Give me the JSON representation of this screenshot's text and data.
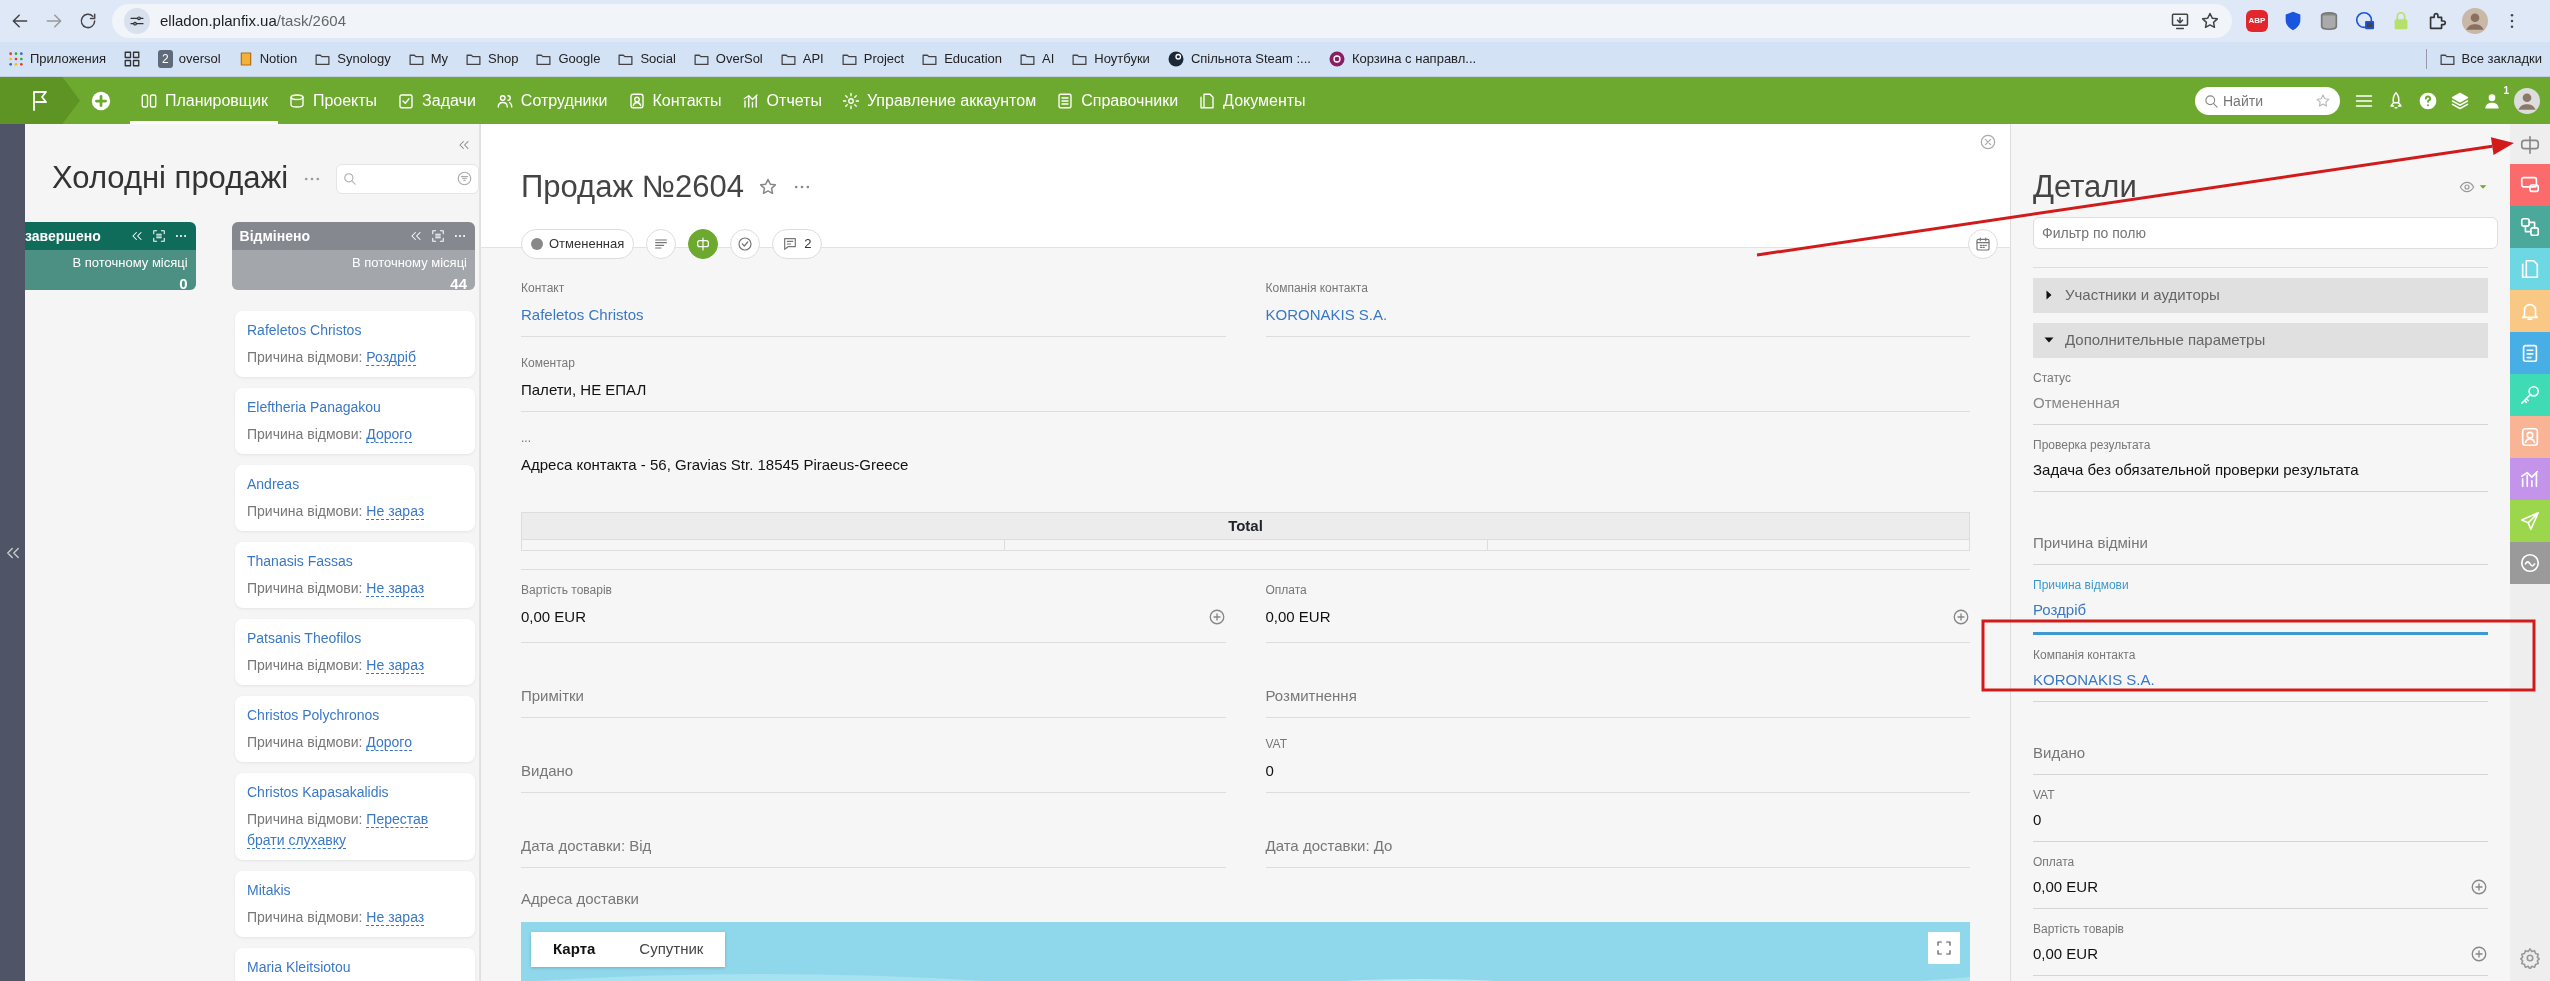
{
  "browser": {
    "url_host": "elladon.planfix.ua",
    "url_path": "/task/2604",
    "extension_label": "ABP",
    "bookmarks": [
      {
        "kind": "apps",
        "label": "Приложения"
      },
      {
        "kind": "grid"
      },
      {
        "kind": "badge",
        "badge": "2",
        "label": "oversol"
      },
      {
        "kind": "notebook",
        "label": "Notion"
      },
      {
        "kind": "folder",
        "label": "Synology"
      },
      {
        "kind": "folder",
        "label": "My"
      },
      {
        "kind": "folder",
        "label": "Shop"
      },
      {
        "kind": "folder",
        "label": "Google"
      },
      {
        "kind": "folder",
        "label": "Social"
      },
      {
        "kind": "folder",
        "label": "OverSol"
      },
      {
        "kind": "folder",
        "label": "API"
      },
      {
        "kind": "folder",
        "label": "Project"
      },
      {
        "kind": "folder",
        "label": "Education"
      },
      {
        "kind": "folder",
        "label": "AI"
      },
      {
        "kind": "folder",
        "label": "Ноутбуки"
      },
      {
        "kind": "steam",
        "label": "Спільнота Steam :..."
      },
      {
        "kind": "site",
        "label": "Корзина с направл..."
      }
    ],
    "all_bookmarks": "Все закладки"
  },
  "app_nav": {
    "items": [
      {
        "label": "Планировщик",
        "selected": true
      },
      {
        "label": "Проекты",
        "selected": false
      },
      {
        "label": "Задачи",
        "selected": false
      },
      {
        "label": "Сотрудники",
        "selected": false
      },
      {
        "label": "Контакты",
        "selected": false
      },
      {
        "label": "Отчеты",
        "selected": false
      },
      {
        "label": "Управление аккаунтом",
        "selected": false
      },
      {
        "label": "Справочники",
        "selected": false
      },
      {
        "label": "Документы",
        "selected": false
      }
    ],
    "search": {
      "placeholder": "Найти"
    },
    "user_badge": "1"
  },
  "board": {
    "title": "Холодні продажі",
    "columns": [
      {
        "title": "завершено",
        "period": "В поточному місяці",
        "count": "0",
        "color": "#0f6b5a"
      },
      {
        "title": "Відмінено",
        "period": "В поточному місяці",
        "count": "44",
        "color": "#85888f"
      }
    ],
    "cards": [
      {
        "name": "Rafeletos Christos",
        "reason_label": "Причина відмови:",
        "reason": "Роздріб"
      },
      {
        "name": "Eleftheria Panagakou",
        "reason_label": "Причина відмови:",
        "reason": "Дорого"
      },
      {
        "name": "Andreas",
        "reason_label": "Причина відмови:",
        "reason": "Не зараз"
      },
      {
        "name": "Thanasis Fassas",
        "reason_label": "Причина відмови:",
        "reason": "Не зараз"
      },
      {
        "name": "Patsanis Theofilos",
        "reason_label": "Причина відмови:",
        "reason": "Не зараз"
      },
      {
        "name": "Christos Polychronos",
        "reason_label": "Причина відмови:",
        "reason": "Дорого"
      },
      {
        "name": "Christos Kapasakalidis",
        "reason_label": "Причина відмови:",
        "reason": "Перестав брати слухавку"
      },
      {
        "name": "Mitakis",
        "reason_label": "Причина відмови:",
        "reason": "Не зараз"
      },
      {
        "name": "Maria Kleitsiotou"
      }
    ]
  },
  "task": {
    "title": "Продаж №2604",
    "status": "Отмененная",
    "comments": "2",
    "rows_top": [
      {
        "cells": [
          {
            "label": "Контакт",
            "value": "Rafeletos Christos",
            "kind": "link"
          },
          {
            "label": "Компанія контакта",
            "value": "KORONAKIS S.A.",
            "kind": "link"
          }
        ]
      },
      {
        "cells": [
          {
            "label": "Коментар",
            "value": "Палети, НЕ ЕПАЛ",
            "kind": "text"
          }
        ]
      },
      {
        "cells": [
          {
            "label": "...",
            "value": "Адреса контакта - 56, Gravias Str. 18545 Piraeus-Greece",
            "kind": "note"
          }
        ]
      }
    ],
    "total_table": {
      "header": "Total"
    },
    "rows_bottom": [
      {
        "cells": [
          {
            "label": "Вартість товарів",
            "value": "0,00 EUR",
            "kind": "money"
          },
          {
            "label": "Оплата",
            "value": "0,00 EUR",
            "kind": "money"
          }
        ]
      },
      {
        "cells": [
          {
            "label": "Примітки",
            "kind": "empty"
          },
          {
            "label": "Розмитнення",
            "kind": "empty"
          }
        ]
      },
      {
        "cells": [
          {
            "label": "Видано",
            "kind": "empty"
          },
          {
            "label": "VAT",
            "value": "0",
            "kind": "text"
          }
        ]
      },
      {
        "cells": [
          {
            "label": "Дата доставки: Від",
            "kind": "empty"
          },
          {
            "label": "Дата доставки: До",
            "kind": "empty"
          }
        ]
      }
    ],
    "delivery_label": "Адреса доставки",
    "map": {
      "kind": "picture",
      "tabs": [
        {
          "label": "Карта",
          "selected": true
        },
        {
          "label": "Супутник",
          "selected": false
        }
      ]
    }
  },
  "details": {
    "title": "Детали",
    "filter_placeholder": "Фильтр по полю",
    "sections": [
      {
        "label": "Участники и аудиторы",
        "expanded": false
      },
      {
        "label": "Дополнительные параметры",
        "expanded": true
      }
    ],
    "fields": [
      {
        "label": "Статус",
        "value": "Отмененная",
        "kind": "muted",
        "focused": false
      },
      {
        "label": "Проверка результата",
        "value": "Задача без обязательной проверки результата",
        "kind": "text",
        "focused": false
      },
      {
        "label": "Причина відміни",
        "kind": "empty",
        "focused": false
      },
      {
        "label": "Причина відмови",
        "value": "Роздріб",
        "kind": "dashed-link",
        "focused": true
      },
      {
        "label": "Компанія контакта",
        "value": "KORONAKIS S.A.",
        "kind": "link",
        "focused": false
      },
      {
        "label": "Видано",
        "kind": "empty",
        "focused": false
      },
      {
        "label": "VAT",
        "value": "0",
        "kind": "text",
        "focused": false
      },
      {
        "label": "Оплата",
        "value": "0,00 EUR",
        "kind": "money",
        "focused": false
      },
      {
        "label": "Вартість товарів",
        "value": "0,00 EUR",
        "kind": "money",
        "focused": false
      }
    ]
  },
  "rail": [
    {
      "color": "#fb6b6b"
    },
    {
      "color": "#4aa99b"
    },
    {
      "color": "#6dd7e3"
    },
    {
      "color": "#f9c885"
    },
    {
      "color": "#47aee6"
    },
    {
      "color": "#3edbb5"
    },
    {
      "color": "#f9b496"
    },
    {
      "color": "#c493ea"
    },
    {
      "color": "#9bd64c"
    },
    {
      "color": "#9a9a9a"
    }
  ],
  "annotations": [
    {
      "kind": "arrow"
    },
    {
      "kind": "rectangle"
    }
  ]
}
